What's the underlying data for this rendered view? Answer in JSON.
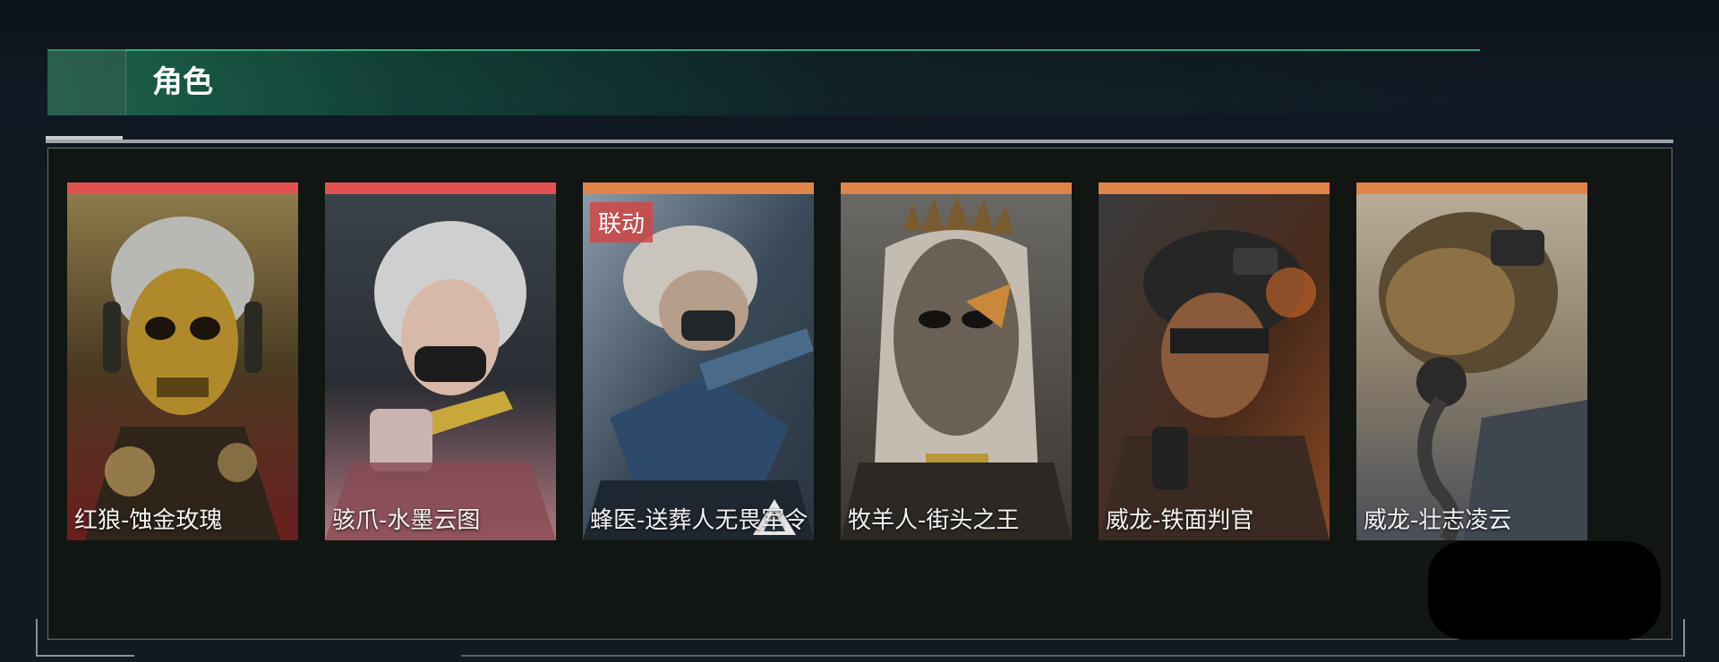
{
  "section": {
    "title": "角色"
  },
  "colors": {
    "red_rarity": "#e05252",
    "orange_rarity": "#e0844a",
    "accent_green": "#2fbf80"
  },
  "cards": [
    {
      "name": "红狼-蚀金玫瑰",
      "rarity_color": "#e05252",
      "icon": "skull-mask-portrait"
    },
    {
      "name": "骇爪-水墨云图",
      "rarity_color": "#e05252",
      "icon": "masked-woman-portrait"
    },
    {
      "name": "蜂医-送葬人无畏军令",
      "rarity_color": "#e0844a",
      "icon": "hooded-soldier-portrait",
      "badge": "联动"
    },
    {
      "name": "牧羊人-街头之王",
      "rarity_color": "#e0844a",
      "icon": "spiked-mask-portrait"
    },
    {
      "name": "威龙-铁面判官",
      "rarity_color": "#e0844a",
      "icon": "helmet-soldier-portrait"
    },
    {
      "name": "威龙-壮志凌云",
      "rarity_color": "#e0844a",
      "icon": "pilot-helmet-portrait"
    }
  ]
}
